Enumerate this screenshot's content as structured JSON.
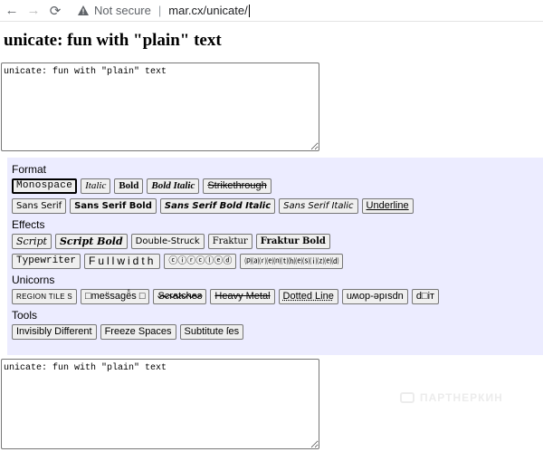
{
  "browser": {
    "back_icon": "←",
    "forward_icon": "→",
    "reload_icon": "⟳",
    "not_secure": "Not secure",
    "separator": "|",
    "url": "mar.cx/unicate/"
  },
  "page": {
    "title": "unicate: fun with \"plain\" text",
    "input_value": "unicate: fun with \"plain\" text",
    "output_value": "unicate: fun with \"plain\" text"
  },
  "sections": {
    "format": "Format",
    "effects": "Effects",
    "unicorns": "Unicorns",
    "tools": "Tools"
  },
  "format_buttons": {
    "monospace": "Monospace",
    "italic": "Italic",
    "bold": "Bold",
    "bold_italic": "Bold Italic",
    "strikethrough": "Strikethrough",
    "sans_serif": "Sans Serif",
    "sans_serif_bold": "Sans Serif Bold",
    "sans_serif_bold_italic": "Sans Serif Bold Italic",
    "sans_serif_italic": "Sans Serif Italic",
    "underline": "Underline"
  },
  "effects_buttons": {
    "script": "Script",
    "script_bold": "Script Bold",
    "double_struck": "Double-Struck",
    "fraktur": "Fraktur",
    "fraktur_bold": "Fraktur Bold",
    "typewriter": "Typewriter",
    "fullwidth": "Fullwidth",
    "circled": "ⓒⓘⓡⓒⓛⓔⓓ",
    "parenthesized": "⒫⒜⒭⒠⒩⒯⒣⒠⒮⒤⒵⒠⒟"
  },
  "unicorns_buttons": {
    "region_tiles": "REGION TILE S",
    "mess_message": "□mes̈sagë̊s □",
    "scratches": "Scratches",
    "heavy_metal": "Heavy Metal",
    "dotted_line": "Dotted Line",
    "upside_down": "uʍop-ǝpısdn",
    "zalgo": "d□іт"
  },
  "tools_buttons": {
    "invisibly_different": "Invisibly Different",
    "freeze_spaces": "Freeze Spaces",
    "substitute_ies": "Subtitute ſes"
  },
  "watermark": "ПАРТНЕРКИН"
}
